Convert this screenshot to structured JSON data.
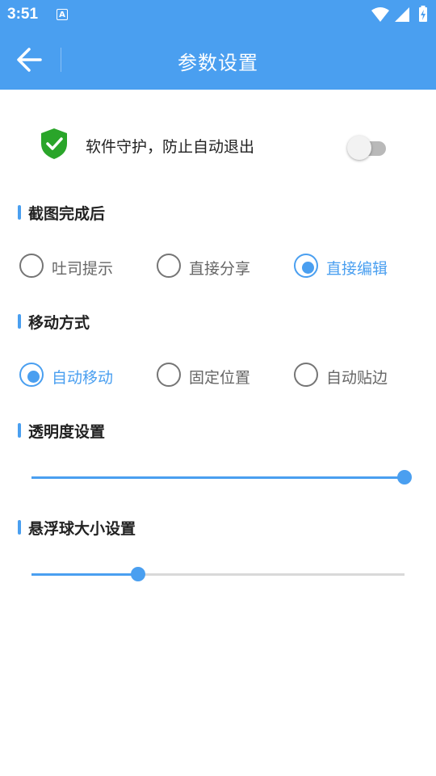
{
  "status_bar": {
    "time": "3:51",
    "notification_glyph": "A",
    "icons": [
      "wifi-icon",
      "signal-icon",
      "battery-charging-icon"
    ]
  },
  "toolbar": {
    "title": "参数设置",
    "back_icon": "arrow-left-icon"
  },
  "guard": {
    "label": "软件守护，防止自动退出",
    "enabled": false,
    "icon": "shield-check-icon",
    "shield_color": "#2aa52a"
  },
  "after_screenshot": {
    "heading": "截图完成后",
    "options": [
      {
        "label": "吐司提示",
        "checked": false
      },
      {
        "label": "直接分享",
        "checked": false
      },
      {
        "label": "直接编辑",
        "checked": true
      }
    ]
  },
  "move_mode": {
    "heading": "移动方式",
    "options": [
      {
        "label": "自动移动",
        "checked": true
      },
      {
        "label": "固定位置",
        "checked": false
      },
      {
        "label": "自动贴边",
        "checked": false
      }
    ]
  },
  "opacity": {
    "heading": "透明度设置",
    "value_percent": 100
  },
  "ball_size": {
    "heading": "悬浮球大小设置",
    "value_percent": 28.5
  },
  "colors": {
    "accent": "#4a9ff0",
    "track": "#d9d9d9",
    "radio_unchecked": "#757575"
  }
}
